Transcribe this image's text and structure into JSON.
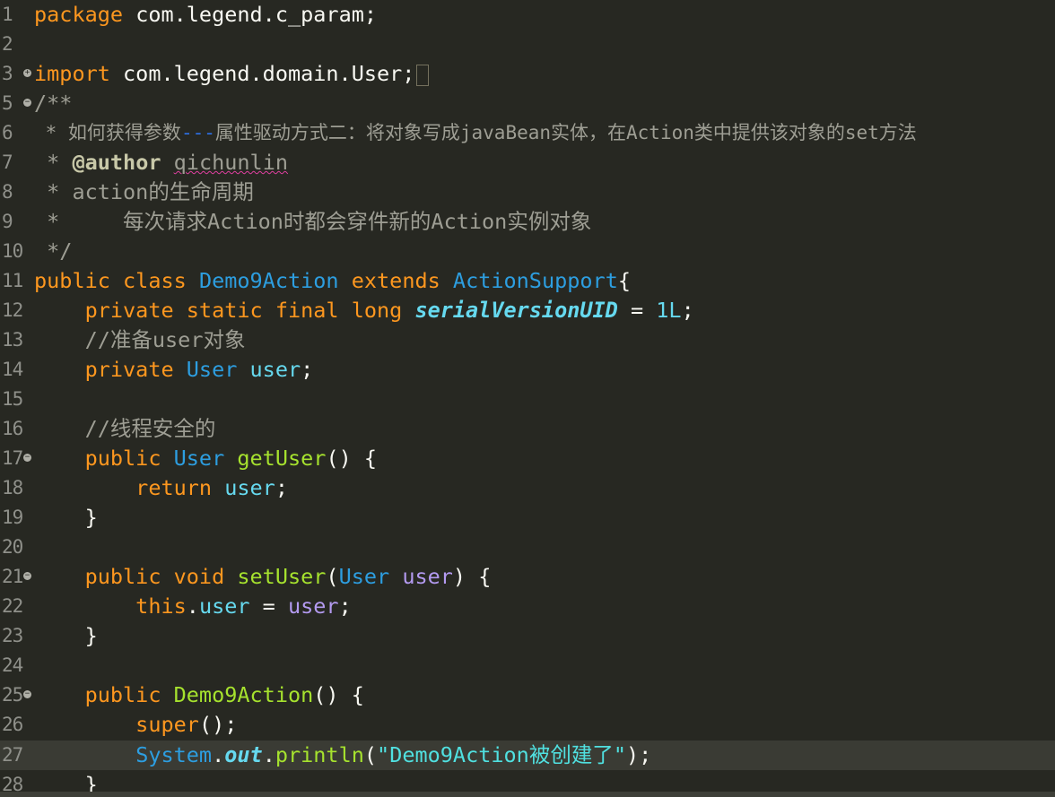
{
  "editor": {
    "lines": [
      {
        "n": "1"
      },
      {
        "n": "2"
      },
      {
        "n": "3"
      },
      {
        "n": "5"
      },
      {
        "n": "6"
      },
      {
        "n": "7"
      },
      {
        "n": "8"
      },
      {
        "n": "9"
      },
      {
        "n": "10"
      },
      {
        "n": "11"
      },
      {
        "n": "12"
      },
      {
        "n": "13"
      },
      {
        "n": "14"
      },
      {
        "n": "15"
      },
      {
        "n": "16"
      },
      {
        "n": "17"
      },
      {
        "n": "18"
      },
      {
        "n": "19"
      },
      {
        "n": "20"
      },
      {
        "n": "21"
      },
      {
        "n": "22"
      },
      {
        "n": "23"
      },
      {
        "n": "24"
      },
      {
        "n": "25"
      },
      {
        "n": "26"
      },
      {
        "n": "27"
      },
      {
        "n": "28"
      }
    ],
    "tokens": {
      "l1_kw": "package",
      "l1_rest": " com.legend.c_param;",
      "l3_kw": "import",
      "l3_rest": " com.legend.domain.User;",
      "l5": "/**",
      "l6_a": " * 如何获得参数",
      "l6_b": "---",
      "l6_c": "属性驱动方式二：将对象写成javaBean实体，在Action类中提供该对象的set方法",
      "l7_a": " * ",
      "l7_tag": "@author",
      "l7_sp": " ",
      "l7_name": "qichunlin",
      "l8": " * action的生命周期",
      "l9": " *     每次请求Action时都会穿件新的Action实例对象",
      "l10": " */",
      "l11_public": "public",
      "l11_class": " class ",
      "l11_name": "Demo9Action",
      "l11_extends": " extends ",
      "l11_super": "ActionSupport",
      "l11_brace": "{",
      "l12_mods": "    private static final long ",
      "l12_field": "serialVersionUID",
      "l12_eq": " = ",
      "l12_num": "1L",
      "l12_semi": ";",
      "l13": "    //准备user对象",
      "l14_mod": "    private ",
      "l14_type": "User",
      "l14_sp": " ",
      "l14_field": "user",
      "l14_semi": ";",
      "l16": "    //线程安全的",
      "l17_mod": "    public ",
      "l17_type": "User",
      "l17_sp": " ",
      "l17_fn": "getUser",
      "l17_rest": "() {",
      "l18_kw": "        return ",
      "l18_field": "user",
      "l18_semi": ";",
      "l19": "    }",
      "l21_mod": "    public void ",
      "l21_fn": "setUser",
      "l21_p1": "(",
      "l21_type": "User",
      "l21_sp": " ",
      "l21_par": "user",
      "l21_rest": ") {",
      "l22_kw": "        this",
      "l22_dot": ".",
      "l22_field": "user",
      "l22_eq": " = ",
      "l22_par": "user",
      "l22_semi": ";",
      "l23": "    }",
      "l25_mod": "    public ",
      "l25_fn": "Demo9Action",
      "l25_rest": "() {",
      "l26_kw": "        super",
      "l26_rest": "();",
      "l27_sp": "        ",
      "l27_type": "System",
      "l27_dot": ".",
      "l27_out": "out",
      "l27_dot2": ".",
      "l27_fn": "println",
      "l27_p1": "(",
      "l27_str": "\"Demo9Action被创建了\"",
      "l27_rest": ");",
      "l28": "    }"
    }
  }
}
